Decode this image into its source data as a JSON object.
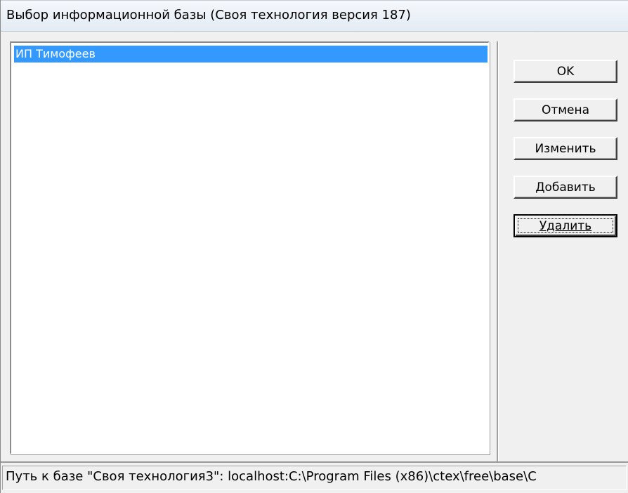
{
  "window": {
    "title": "Выбор информационной базы (Своя технология версия 187)"
  },
  "list": {
    "items": [
      {
        "label": "ИП Тимофеев",
        "selected": true
      }
    ]
  },
  "buttons": {
    "ok_label": "OK",
    "cancel_label": "Отмена",
    "edit_label": "Изменить",
    "add_label": "Добавить",
    "delete_label": "Удалить"
  },
  "status": {
    "path_text": "Путь к базе \"Своя технология3\": localhost:C:\\Program Files (x86)\\ctex\\free\\base\\C"
  },
  "colors": {
    "selection": "#3399ff",
    "window_bg": "#f0f0f0"
  }
}
